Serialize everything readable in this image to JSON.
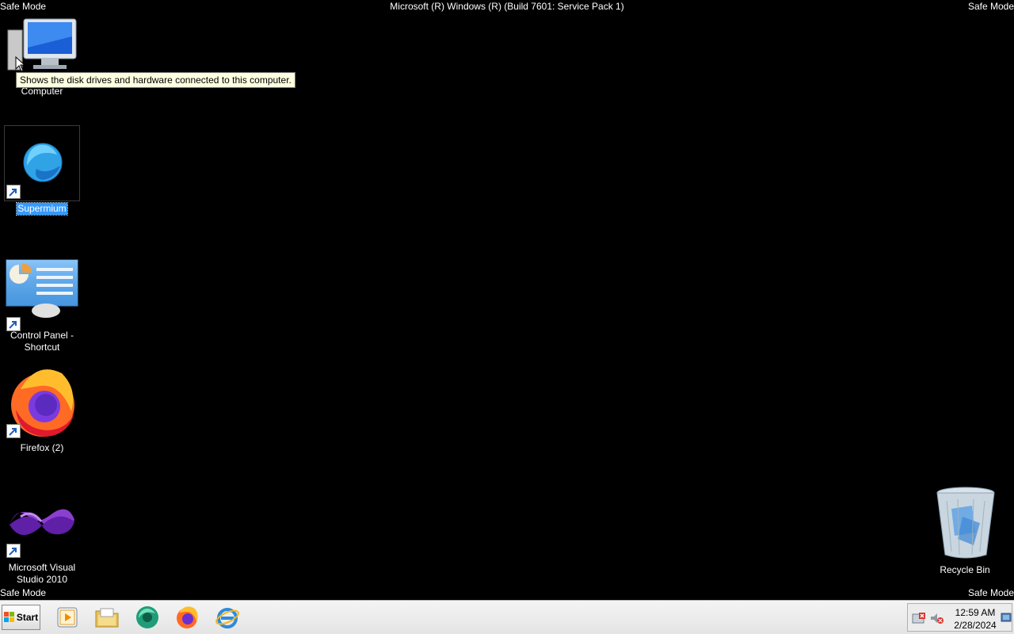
{
  "screen": {
    "safe_mode_label": "Safe Mode",
    "build_text": "Microsoft (R) Windows (R) (Build 7601: Service Pack 1)"
  },
  "tooltip": {
    "text": "Shows the disk drives and hardware connected to this computer."
  },
  "desktop_icons": [
    {
      "label": "Computer",
      "icon": "computer-icon"
    },
    {
      "label": "Supermium",
      "icon": "supermium-icon",
      "selected": true
    },
    {
      "label": "Control Panel - Shortcut",
      "icon": "control-panel-icon"
    },
    {
      "label": "Firefox (2)",
      "icon": "firefox-icon"
    },
    {
      "label": "Microsoft Visual Studio 2010",
      "icon": "visual-studio-icon"
    },
    {
      "label": "Recycle Bin",
      "icon": "recycle-bin-icon"
    }
  ],
  "taskbar": {
    "start_label": "Start",
    "pinned": [
      "media-player-icon",
      "file-explorer-icon",
      "supermium-icon",
      "firefox-icon",
      "internet-explorer-icon"
    ],
    "tray": {
      "icons": [
        "action-center-icon",
        "volume-muted-icon",
        "show-desktop-icon"
      ],
      "time": "12:59 AM",
      "date": "2/28/2024"
    }
  },
  "colors": {
    "desktop_background": "#000000",
    "selection": "#3399ff",
    "tooltip_background": "#ffffe1"
  }
}
